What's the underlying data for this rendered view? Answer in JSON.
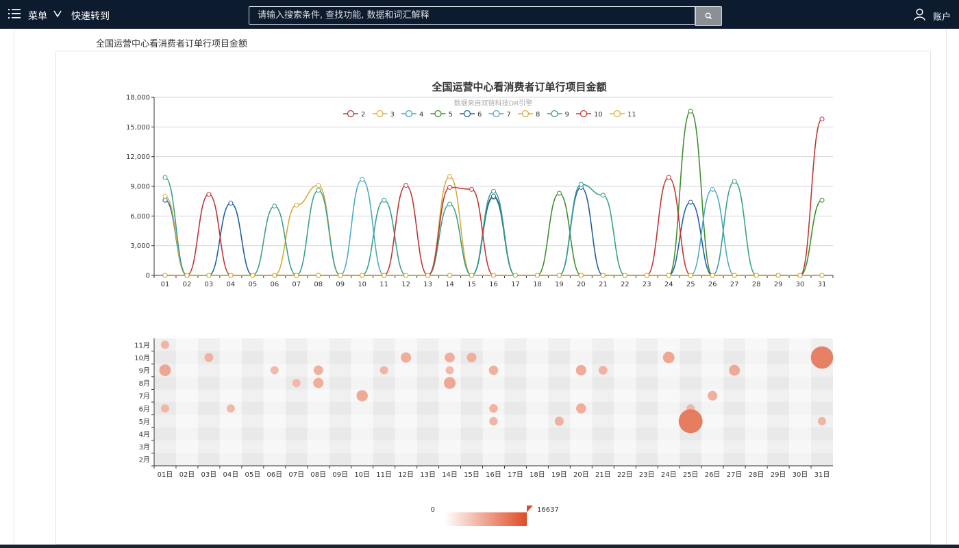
{
  "topbar": {
    "menu_label": "菜单",
    "goto_label": "快速转到",
    "search_placeholder": "请输入搜索条件, 查找功能, 数据和词汇解释",
    "account_label": "账户"
  },
  "breadcrumb": "全国运营中心看消费者订单行项目金额",
  "chart_data": [
    {
      "type": "line",
      "smooth": true,
      "title": "全国运营中心看消费者订单行项目金额",
      "subtitle": "数据来自双链科技DR引擎",
      "xlabel": "",
      "ylabel": "",
      "ylim": [
        0,
        18000
      ],
      "yticks": [
        0,
        3000,
        6000,
        9000,
        12000,
        15000,
        18000
      ],
      "ytick_labels": [
        "0",
        "3,000",
        "6,000",
        "9,000",
        "12,000",
        "15,000",
        "18,000"
      ],
      "grid": true,
      "legend_placement": "top-center",
      "categories": [
        "01",
        "02",
        "03",
        "04",
        "05",
        "06",
        "07",
        "08",
        "09",
        "10",
        "11",
        "12",
        "13",
        "14",
        "15",
        "16",
        "17",
        "18",
        "19",
        "20",
        "21",
        "22",
        "23",
        "24",
        "25",
        "26",
        "27",
        "28",
        "29",
        "30",
        "31"
      ],
      "series": [
        {
          "name": "2",
          "color": "#c23531",
          "values": [
            0,
            0,
            0,
            0,
            0,
            0,
            0,
            0,
            0,
            0,
            0,
            0,
            0,
            0,
            0,
            0,
            0,
            0,
            0,
            0,
            0,
            0,
            0,
            0,
            0,
            0,
            0,
            0,
            0,
            0,
            0
          ]
        },
        {
          "name": "3",
          "color": "#e0b33a",
          "values": [
            0,
            0,
            0,
            0,
            0,
            0,
            0,
            0,
            0,
            0,
            0,
            0,
            0,
            0,
            0,
            0,
            0,
            0,
            0,
            0,
            0,
            0,
            0,
            0,
            0,
            0,
            0,
            0,
            0,
            0,
            0
          ]
        },
        {
          "name": "4",
          "color": "#3fa7c9",
          "values": [
            0,
            0,
            0,
            0,
            0,
            0,
            0,
            0,
            0,
            0,
            0,
            0,
            0,
            0,
            0,
            0,
            0,
            0,
            0,
            0,
            0,
            0,
            0,
            0,
            0,
            0,
            0,
            0,
            0,
            0,
            0
          ]
        },
        {
          "name": "5",
          "color": "#3d8f2e",
          "values": [
            0,
            0,
            0,
            0,
            0,
            0,
            0,
            0,
            0,
            0,
            0,
            0,
            0,
            0,
            0,
            7900,
            0,
            0,
            8300,
            0,
            0,
            0,
            0,
            0,
            16600,
            0,
            0,
            0,
            0,
            0,
            7600
          ]
        },
        {
          "name": "6",
          "color": "#1f5fa8",
          "values": [
            7600,
            0,
            0,
            7300,
            0,
            0,
            0,
            0,
            0,
            0,
            0,
            0,
            0,
            0,
            0,
            8000,
            0,
            0,
            0,
            8900,
            0,
            0,
            0,
            0,
            7400,
            0,
            0,
            0,
            0,
            0,
            0
          ]
        },
        {
          "name": "7",
          "color": "#4aa9c8",
          "values": [
            0,
            0,
            0,
            0,
            0,
            0,
            0,
            0,
            0,
            9700,
            0,
            0,
            0,
            0,
            0,
            0,
            0,
            0,
            0,
            0,
            0,
            0,
            0,
            0,
            0,
            8700,
            0,
            0,
            0,
            0,
            0
          ]
        },
        {
          "name": "8",
          "color": "#d8aa3c",
          "values": [
            8000,
            0,
            0,
            0,
            0,
            0,
            7100,
            9100,
            0,
            0,
            0,
            0,
            0,
            10000,
            0,
            0,
            0,
            0,
            0,
            0,
            0,
            0,
            0,
            0,
            0,
            0,
            0,
            0,
            0,
            0,
            0
          ]
        },
        {
          "name": "9",
          "color": "#3aa08d",
          "values": [
            9900,
            0,
            0,
            0,
            0,
            7000,
            0,
            8600,
            0,
            0,
            7600,
            0,
            0,
            7200,
            0,
            8500,
            0,
            0,
            0,
            9200,
            8100,
            0,
            0,
            0,
            0,
            0,
            9500,
            0,
            0,
            0,
            0
          ]
        },
        {
          "name": "10",
          "color": "#c23531",
          "values": [
            0,
            0,
            8200,
            0,
            0,
            0,
            0,
            0,
            0,
            0,
            0,
            9100,
            0,
            8900,
            8700,
            0,
            0,
            0,
            0,
            0,
            0,
            0,
            0,
            9900,
            0,
            0,
            0,
            0,
            0,
            0,
            15800
          ]
        },
        {
          "name": "11",
          "color": "#e0b33a",
          "values": [
            0,
            0,
            0,
            0,
            0,
            0,
            0,
            0,
            0,
            0,
            0,
            0,
            0,
            0,
            0,
            0,
            0,
            0,
            0,
            0,
            0,
            0,
            0,
            0,
            0,
            0,
            0,
            0,
            0,
            0,
            0
          ]
        }
      ]
    },
    {
      "type": "scatter",
      "subtype": "bubble-punch-card",
      "x_categories": [
        "01日",
        "02日",
        "03日",
        "04日",
        "05日",
        "06日",
        "07日",
        "08日",
        "09日",
        "10日",
        "11日",
        "12日",
        "13日",
        "14日",
        "15日",
        "16日",
        "17日",
        "18日",
        "19日",
        "20日",
        "21日",
        "22日",
        "23日",
        "24日",
        "25日",
        "26日",
        "27日",
        "28日",
        "29日",
        "30日",
        "31日"
      ],
      "y_categories": [
        "2月",
        "3月",
        "4月",
        "5月",
        "6月",
        "7月",
        "8月",
        "9月",
        "10月",
        "11月"
      ],
      "visual_map": {
        "min": 0,
        "max": 16637,
        "min_label": "0",
        "max_label": "16637",
        "color_low": "#fbe5dc",
        "color_high": "#de4b26"
      },
      "points": [
        {
          "x": "01日",
          "y": "11月",
          "value": 7600
        },
        {
          "x": "01日",
          "y": "9月",
          "value": 9900
        },
        {
          "x": "01日",
          "y": "6月",
          "value": 7600
        },
        {
          "x": "03日",
          "y": "10月",
          "value": 8200
        },
        {
          "x": "04日",
          "y": "6月",
          "value": 7300
        },
        {
          "x": "06日",
          "y": "9月",
          "value": 7000
        },
        {
          "x": "07日",
          "y": "8月",
          "value": 7100
        },
        {
          "x": "08日",
          "y": "9月",
          "value": 8600
        },
        {
          "x": "08日",
          "y": "8月",
          "value": 9100
        },
        {
          "x": "10日",
          "y": "7月",
          "value": 9700
        },
        {
          "x": "11日",
          "y": "9月",
          "value": 7600
        },
        {
          "x": "12日",
          "y": "10月",
          "value": 9100
        },
        {
          "x": "14日",
          "y": "10月",
          "value": 8900
        },
        {
          "x": "14日",
          "y": "9月",
          "value": 7200
        },
        {
          "x": "14日",
          "y": "8月",
          "value": 10000
        },
        {
          "x": "15日",
          "y": "10月",
          "value": 8700
        },
        {
          "x": "16日",
          "y": "9月",
          "value": 8500
        },
        {
          "x": "16日",
          "y": "6月",
          "value": 8000
        },
        {
          "x": "16日",
          "y": "5月",
          "value": 7900
        },
        {
          "x": "19日",
          "y": "5月",
          "value": 8300
        },
        {
          "x": "20日",
          "y": "9月",
          "value": 9200
        },
        {
          "x": "20日",
          "y": "6月",
          "value": 8900
        },
        {
          "x": "21日",
          "y": "9月",
          "value": 8100
        },
        {
          "x": "24日",
          "y": "10月",
          "value": 9900
        },
        {
          "x": "25日",
          "y": "6月",
          "value": 7400
        },
        {
          "x": "25日",
          "y": "5月",
          "value": 16600
        },
        {
          "x": "26日",
          "y": "7月",
          "value": 8700
        },
        {
          "x": "27日",
          "y": "9月",
          "value": 9500
        },
        {
          "x": "31日",
          "y": "10月",
          "value": 15800
        },
        {
          "x": "31日",
          "y": "5月",
          "value": 7600
        }
      ]
    }
  ]
}
